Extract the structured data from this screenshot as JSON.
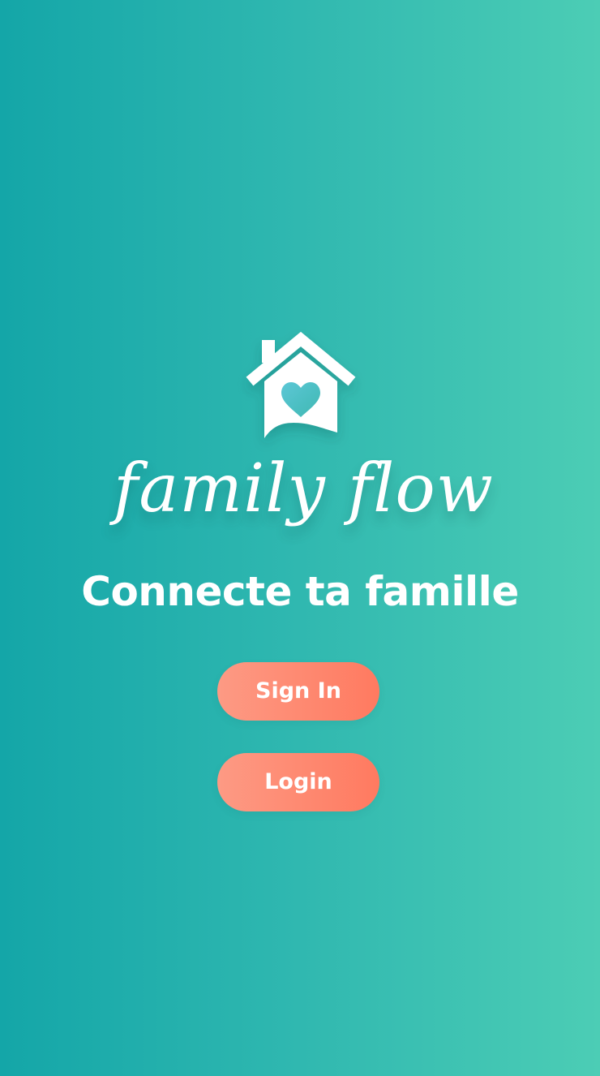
{
  "logo": {
    "wordmark": "family flow",
    "icon": "house-heart-icon"
  },
  "tagline": "Connecte ta famille",
  "buttons": {
    "sign_in": "Sign In",
    "login": "Login"
  },
  "colors": {
    "background_start": "#14a6a8",
    "background_end": "#4ccdb5",
    "button_start": "#fd9a84",
    "button_end": "#ff7a60",
    "heart": "#4fc3c8",
    "text": "#ffffff"
  }
}
